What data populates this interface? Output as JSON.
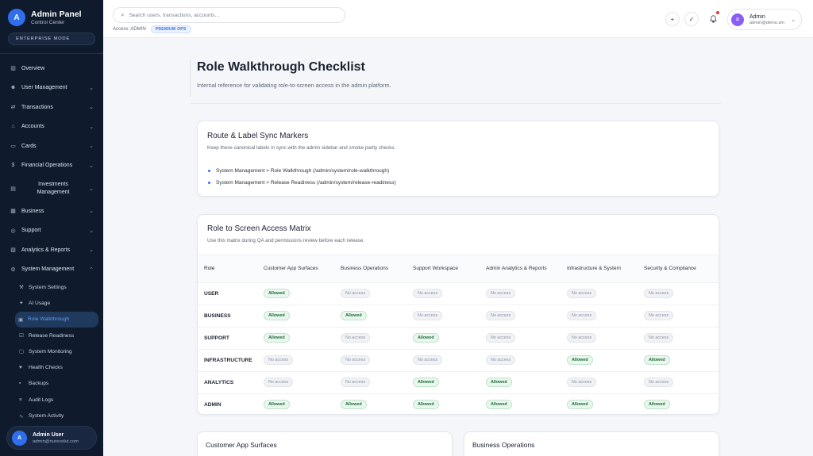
{
  "app": {
    "title": "Admin Panel",
    "subtitle": "Control Center",
    "logo_letter": "A",
    "mode": "ENTERPRISE MODE"
  },
  "sidebar": {
    "items": [
      {
        "label": "Overview",
        "icon": "chart-icon",
        "expandable": false
      },
      {
        "label": "User Management",
        "icon": "users-icon",
        "expandable": true
      },
      {
        "label": "Transactions",
        "icon": "transfer-icon",
        "expandable": true
      },
      {
        "label": "Accounts",
        "icon": "bank-icon",
        "expandable": true
      },
      {
        "label": "Cards",
        "icon": "card-icon",
        "expandable": true
      },
      {
        "label": "Financial Operations",
        "icon": "finance-icon",
        "expandable": true
      },
      {
        "label": "Investments Management",
        "icon": "investments-icon",
        "expandable": true
      },
      {
        "label": "Business",
        "icon": "building-icon",
        "expandable": true
      },
      {
        "label": "Support",
        "icon": "headset-icon",
        "expandable": true
      },
      {
        "label": "Analytics & Reports",
        "icon": "analytics-icon",
        "expandable": true
      },
      {
        "label": "System Management",
        "icon": "settings-icon",
        "expandable": true,
        "expanded": true
      }
    ],
    "sub_items": [
      {
        "label": "System Settings",
        "icon": "wrench-icon"
      },
      {
        "label": "AI Usage",
        "icon": "ai-icon"
      },
      {
        "label": "Role Walkthrough",
        "icon": "clipboard-icon",
        "active": true
      },
      {
        "label": "Release Readiness",
        "icon": "check-square-icon"
      },
      {
        "label": "System Monitoring",
        "icon": "monitor-icon"
      },
      {
        "label": "Health Checks",
        "icon": "heart-icon"
      },
      {
        "label": "Backups",
        "icon": "box-icon"
      },
      {
        "label": "Audit Logs",
        "icon": "log-icon"
      },
      {
        "label": "System Activity",
        "icon": "activity-icon"
      }
    ],
    "user": {
      "initial": "A",
      "name": "Admin User",
      "email": "admin@nurevolut.com"
    }
  },
  "topbar": {
    "search_placeholder": "Search users, transactions, accounts...",
    "access_label": "Access: ADMIN",
    "badge": "PREMIUM OPS",
    "profile": {
      "initial": "a",
      "name": "Admin",
      "email": "admin@demo.sm"
    },
    "icons": [
      "plus-icon",
      "check-circle-icon",
      "bell-icon"
    ]
  },
  "page": {
    "title": "Role Walkthrough Checklist",
    "subtitle": "Internal reference for validating role-to-screen access in the admin platform."
  },
  "sync_card": {
    "title": "Route & Label Sync Markers",
    "subtitle": "Keep these canonical labels in sync with the admin sidebar and smoke parity checks.",
    "markers": [
      "System Management > Role Walkthrough (/admin/system/role-walkthrough)",
      "System Management > Release Readiness (/admin/system/release-readiness)"
    ]
  },
  "matrix": {
    "title": "Role to Screen Access Matrix",
    "subtitle": "Use this matrix during QA and permissions review before each release.",
    "columns": [
      "Role",
      "Customer App Surfaces",
      "Business Operations",
      "Support Workspace",
      "Admin Analytics & Reports",
      "Infrastructure & System",
      "Security & Compliance"
    ],
    "allowed_label": "Allowed",
    "denied_label": "No access",
    "rows": [
      {
        "role": "USER",
        "access": [
          true,
          false,
          false,
          false,
          false,
          false
        ]
      },
      {
        "role": "BUSINESS",
        "access": [
          true,
          true,
          false,
          false,
          false,
          false
        ]
      },
      {
        "role": "SUPPORT",
        "access": [
          true,
          false,
          true,
          false,
          false,
          false
        ]
      },
      {
        "role": "INFRASTRUCTURE",
        "access": [
          false,
          false,
          false,
          false,
          true,
          true
        ]
      },
      {
        "role": "ANALYTICS",
        "access": [
          false,
          false,
          true,
          true,
          false,
          false
        ]
      },
      {
        "role": "ADMIN",
        "access": [
          true,
          true,
          true,
          true,
          true,
          true
        ]
      }
    ]
  },
  "bottom_cards": [
    "Customer App Surfaces",
    "Business Operations"
  ],
  "colors": {
    "sidebar_bg": "#0f1b2d",
    "accent": "#2f6fed",
    "allowed": "#1d6b38",
    "denied": "#8a93a0"
  }
}
